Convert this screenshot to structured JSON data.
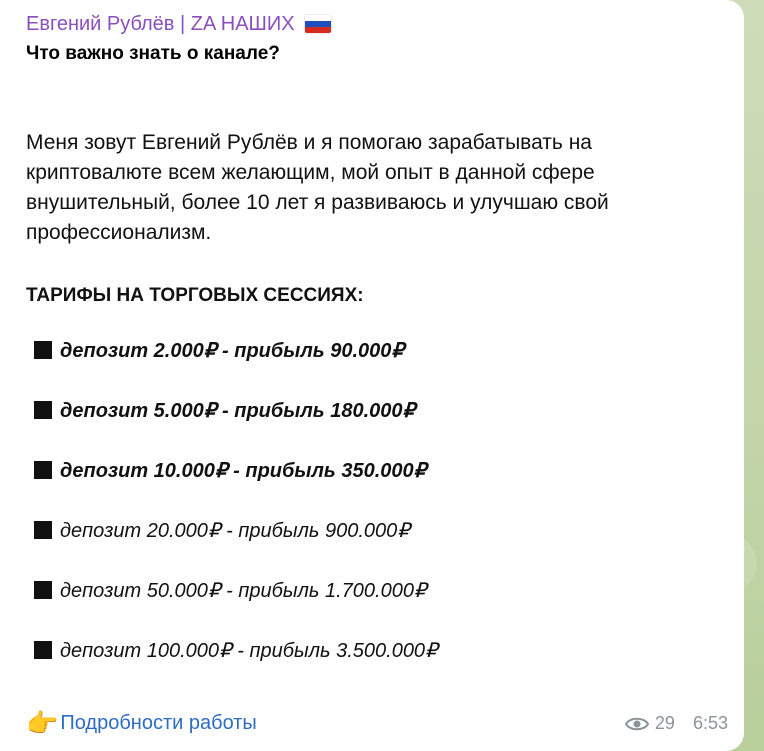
{
  "post": {
    "channel_name": "Евгений Рублёв | ZA НАШИХ",
    "heading": "Что важно знать о канале?",
    "intro": "Меня зовут Евгений Рублёв и я помогаю зарабатывать на криптовалюте всем желающим, мой опыт в данной сфере внушительный, более 10 лет я развиваюсь и улучшаю свой профессионализм.",
    "tariffs_title": "ТАРИФЫ НА ТОРГОВЫХ СЕССИЯХ:",
    "tariffs": [
      {
        "text": "депозит 2.000₽ - прибыль 90.000₽",
        "bold": true
      },
      {
        "text": "депозит 5.000₽ - прибыль 180.000₽",
        "bold": true
      },
      {
        "text": "депозит 10.000₽ - прибыль 350.000₽",
        "bold": true
      },
      {
        "text": "депозит 20.000₽ - прибыль 900.000₽",
        "bold": false
      },
      {
        "text": "депозит 50.000₽ - прибыль 1.700.000₽",
        "bold": false
      },
      {
        "text": "депозит 100.000₽ - прибыль 3.500.000₽",
        "bold": false
      }
    ],
    "details_link": "Подробности работы",
    "views": "29",
    "time": "6:53"
  },
  "icons": {
    "flag": "russia-flag-icon",
    "pointer": "pointing-hand-icon",
    "views": "eye-icon"
  },
  "colors": {
    "channel_name": "#8a4fbf",
    "link": "#2d6cc4",
    "meta": "#8b939b",
    "background": "#c9d8b4"
  }
}
